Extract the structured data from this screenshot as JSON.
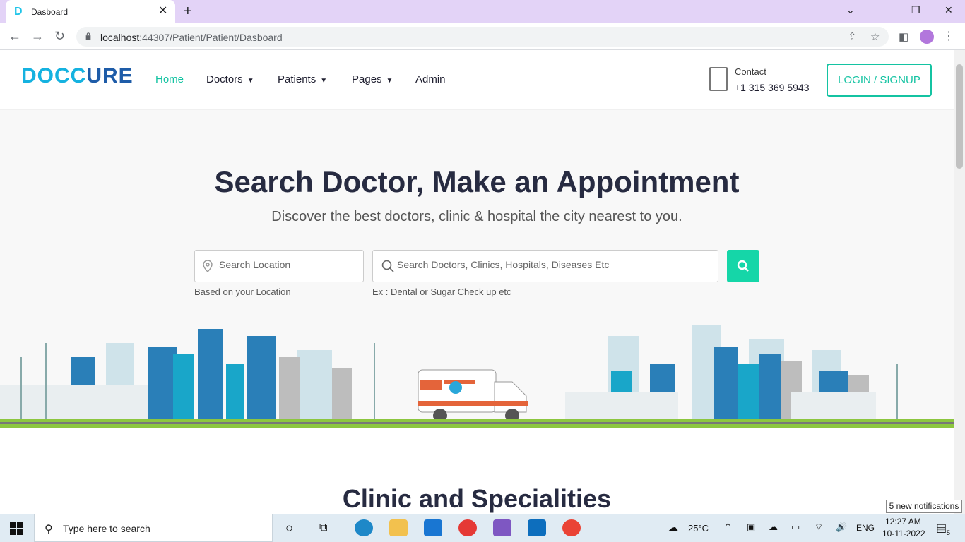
{
  "browser": {
    "tab_title": "Dasboard",
    "tab_favicon": "D",
    "url_host": "localhost",
    "url_rest": ":44307/Patient/Patient/Dasboard"
  },
  "site": {
    "logo_part1": "DOCC",
    "logo_part2": "URE",
    "nav": {
      "home": "Home",
      "doctors": "Doctors",
      "patients": "Patients",
      "pages": "Pages",
      "admin": "Admin"
    },
    "contact_label": "Contact",
    "contact_phone": "+1 315 369 5943",
    "login_label": "LOGIN / SIGNUP"
  },
  "hero": {
    "title": "Search Doctor, Make an Appointment",
    "subtitle": "Discover the best doctors, clinic & hospital the city nearest to you.",
    "location_placeholder": "Search Location",
    "search_placeholder": "Search Doctors, Clinics, Hospitals, Diseases Etc",
    "location_hint": "Based on your Location",
    "search_hint": "Ex : Dental or Sugar Check up etc"
  },
  "section": {
    "specialities_title": "Clinic and Specialities"
  },
  "taskbar": {
    "search_text": "Type here to search",
    "temperature": "25°C",
    "language": "ENG",
    "time": "12:27 AM",
    "date": "10-11-2022",
    "notification_count": "5",
    "notification_popup": "5 new notifications"
  },
  "colors": {
    "accent": "#14c3a2",
    "search_button": "#15d6a8",
    "title_dark": "#272b41",
    "logo_light": "#15b2e0",
    "logo_dark": "#1e5ca8"
  }
}
